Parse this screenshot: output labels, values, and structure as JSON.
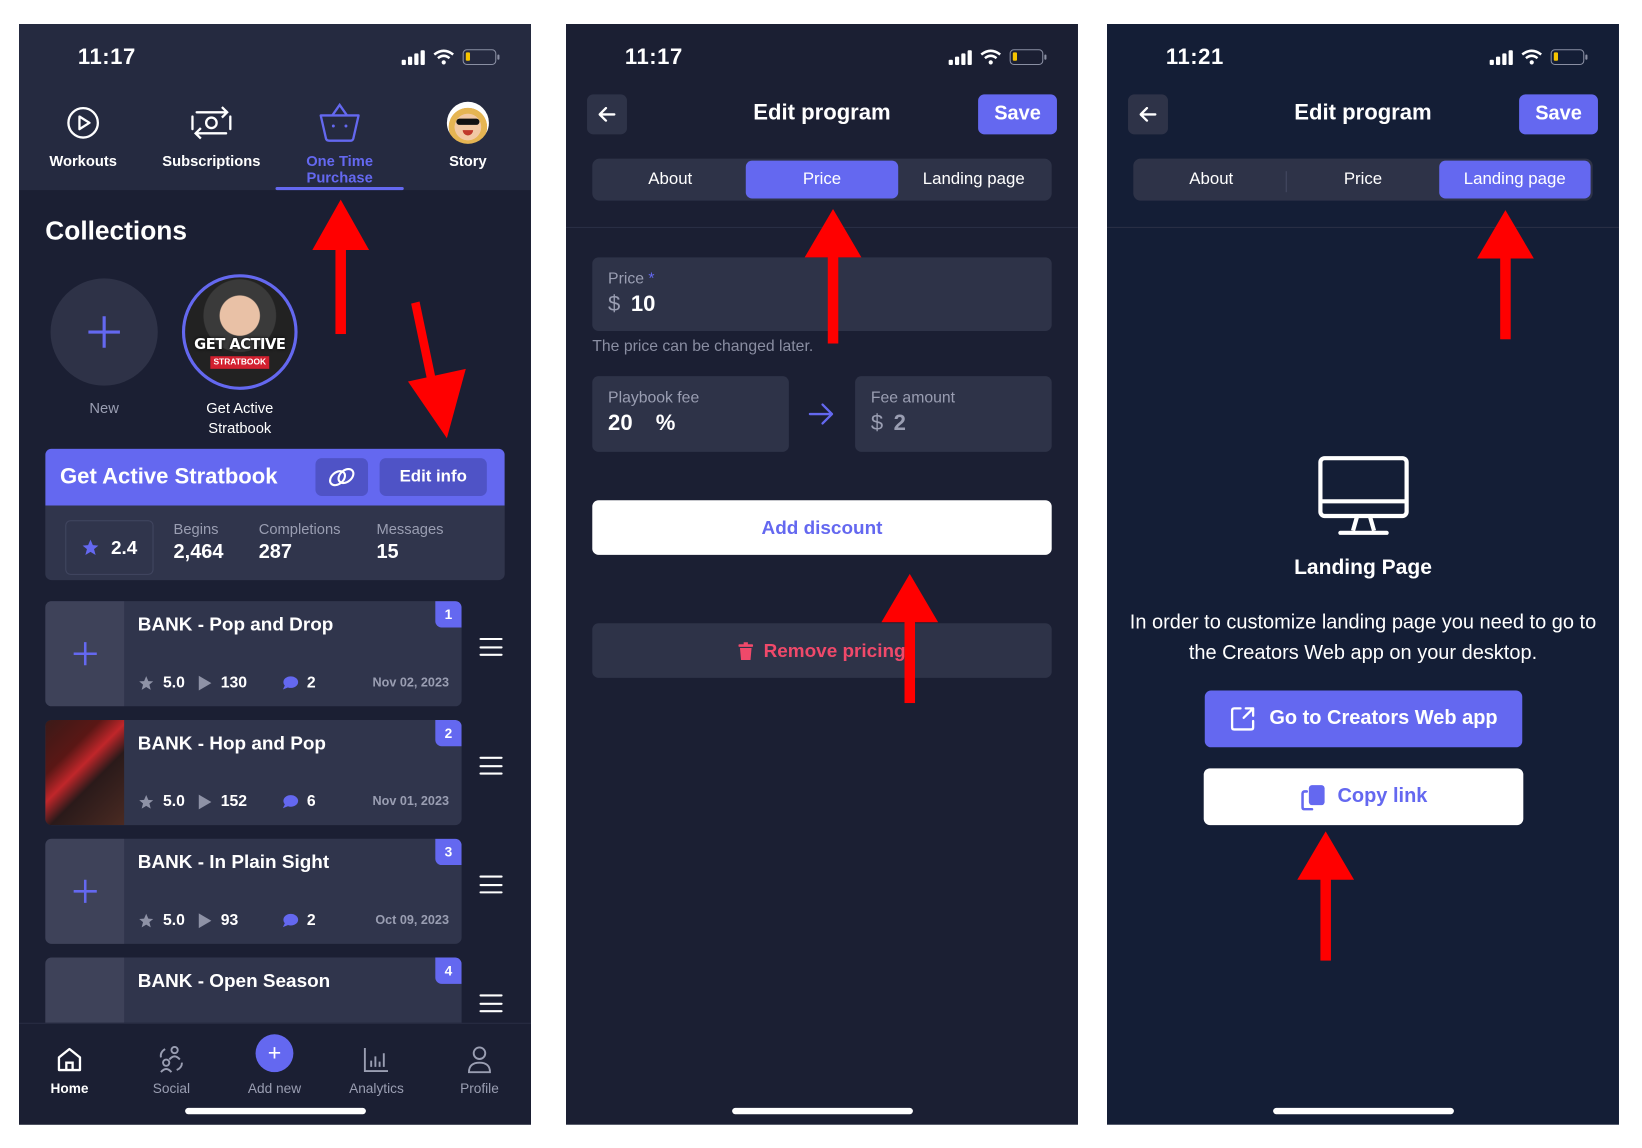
{
  "screens": {
    "home": {
      "status": {
        "time": "11:17"
      },
      "top_tabs": [
        {
          "label": "Workouts",
          "icon": "play-circle-icon",
          "active": false
        },
        {
          "label": "Subscriptions",
          "icon": "money-refresh-icon",
          "active": false
        },
        {
          "label": "One Time Purchase",
          "icon": "basket-icon",
          "active": true
        },
        {
          "label": "Story",
          "icon": "avatar",
          "active": false
        }
      ],
      "section_title": "Collections",
      "collections": [
        {
          "label": "New"
        },
        {
          "label_line1": "Get Active",
          "label_line2": "Stratbook",
          "cover_text": "GET ACTIVE",
          "cover_badge": "STRATBOOK"
        }
      ],
      "program_card": {
        "title": "Get Active Stratbook",
        "edit_label": "Edit info",
        "rating": "2.4",
        "stats": [
          {
            "label": "Begins",
            "value": "2,464"
          },
          {
            "label": "Completions",
            "value": "287"
          },
          {
            "label": "Messages",
            "value": "15"
          }
        ]
      },
      "items": [
        {
          "index": "1",
          "title": "BANK - Pop and Drop",
          "rating": "5.0",
          "plays": "130",
          "comments": "2",
          "date": "Nov 02, 2023"
        },
        {
          "index": "2",
          "title": "BANK - Hop and Pop",
          "rating": "5.0",
          "plays": "152",
          "comments": "6",
          "date": "Nov 01, 2023"
        },
        {
          "index": "3",
          "title": "BANK - In Plain Sight",
          "rating": "5.0",
          "plays": "93",
          "comments": "2",
          "date": "Oct 09, 2023"
        },
        {
          "index": "4",
          "title": "BANK - Open Season"
        }
      ],
      "bottom_nav": [
        {
          "label": "Home",
          "active": true
        },
        {
          "label": "Social",
          "active": false
        },
        {
          "label": "Add new",
          "active": false
        },
        {
          "label": "Analytics",
          "active": false
        },
        {
          "label": "Profile",
          "active": false
        }
      ]
    },
    "price": {
      "status": {
        "time": "11:17"
      },
      "title": "Edit program",
      "save_label": "Save",
      "tabs": [
        {
          "label": "About",
          "active": false
        },
        {
          "label": "Price",
          "active": true
        },
        {
          "label": "Landing page",
          "active": false
        }
      ],
      "price_field": {
        "label": "Price",
        "required_mark": "*",
        "currency": "$",
        "value": "10"
      },
      "hint": "The price can be changed later.",
      "fee_field": {
        "label": "Playbook fee",
        "value": "20",
        "unit": "%"
      },
      "fee_amount_field": {
        "label": "Fee amount",
        "currency": "$",
        "value": "2"
      },
      "add_discount_label": "Add discount",
      "remove_pricing_label": "Remove pricing"
    },
    "landing": {
      "status": {
        "time": "11:21"
      },
      "title": "Edit program",
      "save_label": "Save",
      "tabs": [
        {
          "label": "About",
          "active": false
        },
        {
          "label": "Price",
          "active": false
        },
        {
          "label": "Landing page",
          "active": true
        }
      ],
      "heading": "Landing Page",
      "description": "In order to customize landing page you need to go to the Creators Web app on your desktop.",
      "go_web_label": "Go to Creators Web app",
      "copy_link_label": "Copy link"
    }
  },
  "colors": {
    "accent": "#6468f0",
    "background": "#1b1f33",
    "card": "#30354c",
    "danger": "#f0496a",
    "annotation": "#ff0000"
  }
}
